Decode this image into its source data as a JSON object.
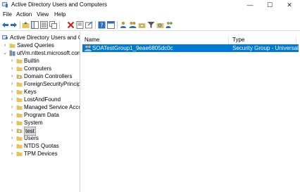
{
  "window": {
    "title": "Active Directory Users and Computers",
    "minimize_glyph": "—",
    "maximize_glyph": "☐",
    "close_glyph": "✕"
  },
  "menu": {
    "items": [
      {
        "label": "File",
        "icon": "menu"
      },
      {
        "label": "Action",
        "icon": "menu"
      },
      {
        "label": "View",
        "icon": "menu"
      },
      {
        "label": "Help",
        "icon": "menu"
      }
    ]
  },
  "toolbar": {
    "icons": [
      "back-arrow-icon",
      "forward-arrow-icon",
      "up-folder-icon",
      "show-console-tree-icon",
      "details-icon",
      "copy-icon",
      "delete-icon",
      "properties-icon",
      "export-icon",
      "help-icon",
      "console-icon",
      "new-user-icon",
      "new-group-icon",
      "new-ou-icon",
      "filter-icon",
      "find-icon",
      "add-to-group-icon"
    ]
  },
  "tree": {
    "root": "Active Directory Users and Com",
    "saved_queries": "Saved Queries",
    "domain": "utVm.nttest.microsoft.com",
    "children": [
      {
        "label": "Builtin",
        "icon": "folder-icon",
        "selected": false
      },
      {
        "label": "Computers",
        "icon": "folder-icon",
        "selected": false
      },
      {
        "label": "Domain Controllers",
        "icon": "ou-icon",
        "selected": false
      },
      {
        "label": "ForeignSecurityPrincipals",
        "icon": "folder-icon",
        "selected": false
      },
      {
        "label": "Keys",
        "icon": "folder-icon",
        "selected": false
      },
      {
        "label": "LostAndFound",
        "icon": "folder-icon",
        "selected": false
      },
      {
        "label": "Managed Service Accounts",
        "icon": "folder-icon",
        "selected": false
      },
      {
        "label": "Program Data",
        "icon": "folder-icon",
        "selected": false
      },
      {
        "label": "System",
        "icon": "folder-icon",
        "selected": false
      },
      {
        "label": "test",
        "icon": "ou-icon",
        "selected": true
      },
      {
        "label": "Users",
        "icon": "folder-icon",
        "selected": false
      },
      {
        "label": "NTDS Quotas",
        "icon": "folder-icon",
        "selected": false
      },
      {
        "label": "TPM Devices",
        "icon": "folder-icon",
        "selected": false
      }
    ]
  },
  "list": {
    "columns": {
      "name": "Name",
      "type": "Type"
    },
    "rows": [
      {
        "name": "SOATestGroup1_9eae6805dc0c",
        "type": "Security Group - Universal",
        "icon": "group-icon"
      }
    ]
  },
  "colors": {
    "selection": "#0078d7",
    "folder": "#e8c25a",
    "tree_selection": "#d9d9d9"
  }
}
